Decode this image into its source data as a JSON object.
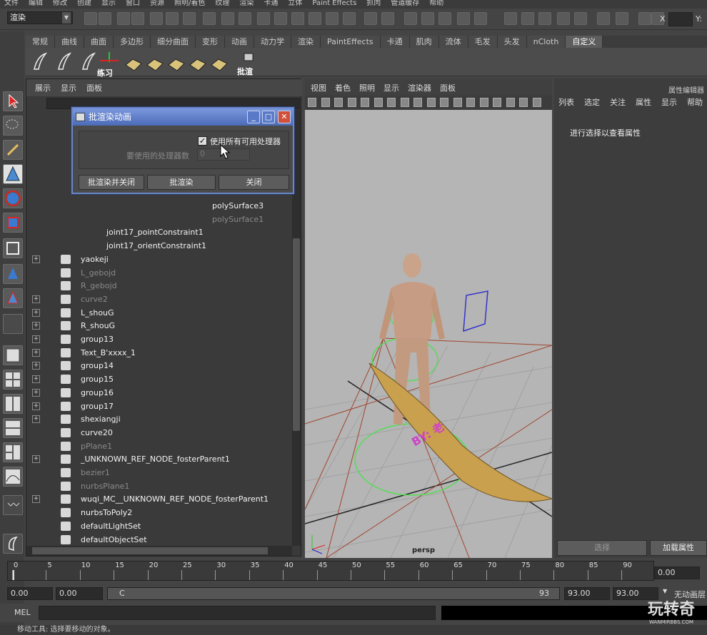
{
  "menubar": [
    "文件",
    "编辑",
    "修改",
    "创建",
    "显示",
    "窗口",
    "资源",
    "照明/着色",
    "纹理",
    "渲染",
    "卡通",
    "立体",
    "Paint Effects",
    "抓肉",
    "管道缓存",
    "帮助"
  ],
  "status": {
    "mode": "渲染",
    "coord_label": "X",
    "coord_label2": "Y:"
  },
  "shelf": {
    "tabs": [
      "常规",
      "曲线",
      "曲面",
      "多边形",
      "细分曲面",
      "变形",
      "动画",
      "动力学",
      "渲染",
      "PaintEffects",
      "卡通",
      "肌肉",
      "流体",
      "毛发",
      "头发",
      "nCloth",
      "自定义"
    ],
    "active_tab": "自定义",
    "labels": [
      "练习",
      "批渲"
    ]
  },
  "outliner": {
    "menu": [
      "展示",
      "显示",
      "面板"
    ],
    "rows": [
      {
        "label": "polySurface3",
        "dim": false
      },
      {
        "label": "polySurface1",
        "dim": true
      },
      {
        "label": "joint17_pointConstraint1",
        "dim": false
      },
      {
        "label": "joint17_orientConstraint1",
        "dim": false
      },
      {
        "label": "yaokeji",
        "dim": false
      },
      {
        "label": "L_gebojd",
        "dim": true
      },
      {
        "label": "R_gebojd",
        "dim": true
      },
      {
        "label": "curve2",
        "dim": true
      },
      {
        "label": "L_shouG",
        "dim": false
      },
      {
        "label": "R_shouG",
        "dim": false
      },
      {
        "label": "group13",
        "dim": false
      },
      {
        "label": "Text_B'xxxx_1",
        "dim": false
      },
      {
        "label": "group14",
        "dim": false
      },
      {
        "label": "group15",
        "dim": false
      },
      {
        "label": "group16",
        "dim": false
      },
      {
        "label": "group17",
        "dim": false
      },
      {
        "label": "shexiangji",
        "dim": false
      },
      {
        "label": "curve20",
        "dim": false
      },
      {
        "label": "pPlane1",
        "dim": true
      },
      {
        "label": "_UNKNOWN_REF_NODE_fosterParent1",
        "dim": false
      },
      {
        "label": "bezier1",
        "dim": true
      },
      {
        "label": "nurbsPlane1",
        "dim": true
      },
      {
        "label": "wuqi_MC__UNKNOWN_REF_NODE_fosterParent1",
        "dim": false
      },
      {
        "label": "nurbsToPoly2",
        "dim": false
      },
      {
        "label": "defaultLightSet",
        "dim": false
      },
      {
        "label": "defaultObjectSet",
        "dim": false
      }
    ]
  },
  "dialog": {
    "title": "批渲染动画",
    "use_all_label": "使用所有可用处理器",
    "use_all_checked": "✓",
    "processors_label": "要使用的处理器数",
    "processors_value": "0",
    "buttons": [
      "批渲染并关闭",
      "批渲染",
      "关闭"
    ]
  },
  "viewport": {
    "menu": [
      "视图",
      "着色",
      "照明",
      "显示",
      "渲染器",
      "面板"
    ],
    "camera": "persp",
    "annotation": "BY: 老"
  },
  "attr_editor": {
    "title": "属性编辑器",
    "menu": [
      "列表",
      "选定",
      "关注",
      "属性",
      "显示",
      "帮助"
    ],
    "hint": "进行选择以查看属性",
    "select_btn": "选择",
    "load_btn": "加载属性"
  },
  "timeline": {
    "ticks": [
      "0",
      "5",
      "10",
      "15",
      "20",
      "25",
      "30",
      "35",
      "40",
      "45",
      "50",
      "55",
      "60",
      "65",
      "70",
      "75",
      "80",
      "85",
      "90"
    ],
    "current_frame": "0.00"
  },
  "range": {
    "start": "0.00",
    "start2": "0.00",
    "slider_start": "C",
    "slider_end": "93",
    "end": "93.00",
    "end2": "93.00",
    "no_anim": "无动画层"
  },
  "cmd": {
    "label": "MEL"
  },
  "help_line": "移动工具: 选择要移动的对象。",
  "watermark": {
    "title": "玩转奇",
    "url": "WANMIRBBS.COM"
  }
}
